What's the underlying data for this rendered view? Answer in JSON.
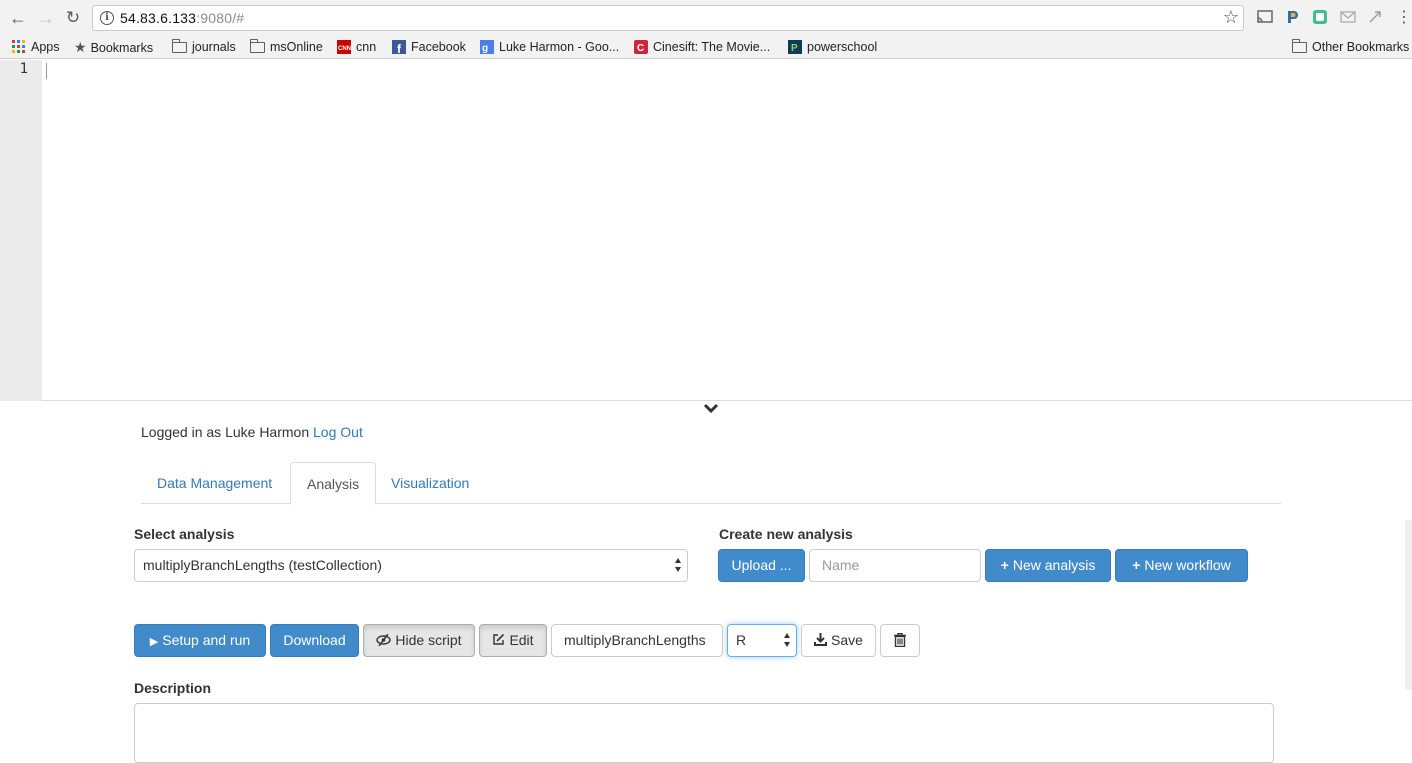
{
  "browser": {
    "url_host": "54.83.6.133",
    "url_rest": ":9080/#",
    "bookmarks": [
      {
        "label": "Apps"
      },
      {
        "label": "Bookmarks"
      },
      {
        "label": "journals"
      },
      {
        "label": "msOnline"
      },
      {
        "label": "cnn"
      },
      {
        "label": "Facebook"
      },
      {
        "label": "Luke Harmon - Goo..."
      },
      {
        "label": "Cinesift: The Movie..."
      },
      {
        "label": "powerschool"
      }
    ],
    "other_bookmarks": "Other Bookmarks"
  },
  "editor": {
    "line_numbers": [
      "1"
    ]
  },
  "session": {
    "logged_in_prefix": "Logged in as",
    "user": "Luke Harmon",
    "logout": "Log Out"
  },
  "tabs": [
    {
      "label": "Data Management",
      "active": false
    },
    {
      "label": "Analysis",
      "active": true
    },
    {
      "label": "Visualization",
      "active": false
    }
  ],
  "select_analysis": {
    "label": "Select analysis",
    "value": "multiplyBranchLengths (testCollection)"
  },
  "create_analysis": {
    "label": "Create new analysis",
    "upload_label": "Upload ...",
    "name_placeholder": "Name",
    "new_analysis_label": "New analysis",
    "new_workflow_label": "New workflow"
  },
  "actions": {
    "setup_run_label": "Setup and run",
    "download_label": "Download",
    "hide_script_label": "Hide script",
    "edit_label": "Edit",
    "script_name": "multiplyBranchLengths",
    "language": "R",
    "save_label": "Save"
  },
  "description": {
    "label": "Description",
    "value": ""
  },
  "colors": {
    "primary": "#428bca",
    "link": "#337ab7"
  }
}
